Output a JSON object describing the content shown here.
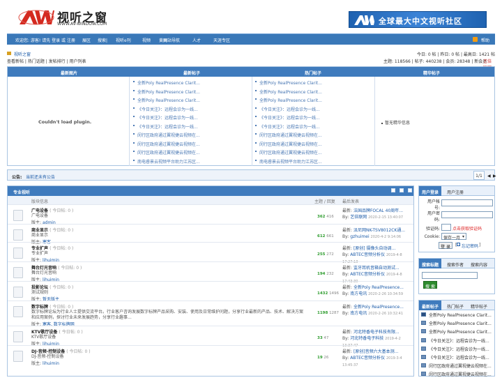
{
  "logo": {
    "cn": "视听之窗",
    "url": "WWW.AV-WINDOW.COM",
    "mark": "AW"
  },
  "banner": {
    "text": "全球最大中文视听社区",
    "mark": "AW"
  },
  "nav": {
    "items": [
      "欢迎您: 游客! 请先 登录 或 注册",
      "展区",
      "搜索|",
      "视听e刊",
      "视频",
      "黄页",
      "网站导航",
      "人才",
      "天涯专区",
      "",
      "",
      "帮助"
    ]
  },
  "info": {
    "breadcrumb": "视听之窗",
    "links": "查看新帖 | 热门话题 | 发帖排行 | 用户列表",
    "today": "今日: 0 帖 | 昨日: 0 帖 | 最高日: 1421 帖",
    "stats": "主题: 118566 | 帖子: 440238 | 会员: 28348 | 新会员",
    "newmember": "艺倍联网"
  },
  "top": {
    "headers": [
      "最新图片",
      "最新帖子",
      "热门帖子",
      "精华帖子"
    ],
    "noplugin": "Couldn't load plugin.",
    "newest": [
      "全新Poly RealPresence Clarit...",
      "全新Poly RealPresence Clarit...",
      "全新Poly RealPresence Clarit...",
      "《今日关注》：远程会诊为一线...",
      "《今日关注》：远程会诊为一线...",
      "《今日关注》：远程会诊为一线...",
      "闵行区政府通过翼视捷云视频在...",
      "闵行区政府通过翼视捷云视频在...",
      "闵行区政府通过翼视捷云视频在...",
      "南电睿景云视频平台助力江苏区..."
    ],
    "hot": [
      "全新Poly RealPresence Clarit...",
      "全新Poly RealPresence Clarit...",
      "全新Poly RealPresence Clarit...",
      "《今日关注》：远程会诊为一线...",
      "《今日关注》：远程会诊为一线...",
      "《今日关注》：远程会诊为一线...",
      "闵行区政府通过翼视捷云视频在...",
      "闵行区政府通过翼视捷云视频在...",
      "闵行区政府通过翼视捷云视频在...",
      "南电睿景云视频平台助力江苏区..."
    ],
    "elite": "暂无精华信息"
  },
  "notice": {
    "label": "公告:",
    "text": "当前还未有公告",
    "page": "1/1",
    "prev": "◀",
    "next": "▶"
  },
  "forum": {
    "title": "专业视听",
    "cols": [
      "版块信息",
      "主题 / 回复",
      "最后发表"
    ],
    "rows": [
      {
        "name": "广电设备",
        "today": "( 今日帖: 0 )",
        "desc": "广电设备",
        "modlabel": "版主:",
        "mod": "admin",
        "topics": "362",
        "posts": "416",
        "last_label": "最新:",
        "last": "法国品牌FOCAL 40周年...",
        "by": "By:",
        "user": "艺倍联网",
        "time": "2020-2-15 13:40:07"
      },
      {
        "name": "商业显示",
        "today": "( 今日帖: 0 )",
        "desc": "商业显示",
        "modlabel": "版主:",
        "mod": "寒客",
        "topics": "612",
        "posts": "661",
        "last_label": "最新:",
        "last": "派尼网NK-TSV8012CK通...",
        "by": "By:",
        "user": "gzhuimei",
        "time": "2020-4-2 9:14:06"
      },
      {
        "name": "专业扩声",
        "today": "( 今日帖: 0 )",
        "desc": "专业扩声",
        "modlabel": "版主:",
        "mod": "lihuimin",
        "topics": "255",
        "posts": "272",
        "last_label": "最新:",
        "last": "[原创] 摄像头自动调...",
        "by": "By:",
        "user": "ABTEC音频分析仪",
        "time": "2019-4-8 17:27:13"
      },
      {
        "name": "舞台灯光音响",
        "today": "( 今日帖: 0 )",
        "desc": "舞台灯光音响",
        "modlabel": "版主:",
        "mod": "lihuimin",
        "topics": "194",
        "posts": "232",
        "last_label": "最新:",
        "last": "监牙耳机音箱自动测试...",
        "by": "By:",
        "user": "ABTEC音频分析仪",
        "time": "2019-4-8 17:43:30"
      },
      {
        "name": "投影论坛",
        "today": "( 今日帖: 0 )",
        "desc": "测试规则",
        "modlabel": "版主:",
        "mod": "暂无版主",
        "topics": "1432",
        "posts": "1496",
        "last_label": "最新:",
        "last": "全新Poly RealPresence...",
        "by": "By:",
        "user": "南方电讯",
        "time": "2020-2-26 10:34:59"
      },
      {
        "name": "数字标牌",
        "today": "( 今日帖: 0 )",
        "desc": "数字标牌论坛为行业人士提供交流平台。行业客户咨询发展数字标牌产品采购、安装、使用及日常维护问题，分享行业最新的产品、技术、解决方案和应用案例，探讨行业未来发展趋势，分享行业趣事...",
        "modlabel": "版主:",
        "mod": "寒客, 数字标牌网",
        "topics": "1198",
        "posts": "1287",
        "last_label": "最新:",
        "last": "全新Poly RealPresence...",
        "by": "By:",
        "user": "南方电讯",
        "time": "2020-2-26 10:32:41"
      },
      {
        "name": "KTV歌厅设备",
        "today": "( 今日帖: 0 )",
        "desc": "KTV歌厅设备",
        "modlabel": "版主:",
        "mod": "lihuimin",
        "topics": "33",
        "posts": "47",
        "last_label": "最新:",
        "last": "河北特香电子科技有限...",
        "by": "By:",
        "user": "河北特香电子科技",
        "time": "2019-4-2 13:37:47"
      },
      {
        "name": "DJ-音频-控制设备",
        "today": "( 今日帖: 0 )",
        "desc": "DJ-音频-控制设备",
        "modlabel": "版主:",
        "mod": "lihuimin",
        "topics": "19",
        "posts": "26",
        "last_label": "最新:",
        "last": "[原创]音频六大基本测...",
        "by": "By:",
        "user": "ABTEC音频分析仪",
        "time": "2019-3-4 13:45:37"
      }
    ]
  },
  "login": {
    "tabs": [
      "用户登录",
      "用户注册"
    ],
    "user_label": "用户帐号:",
    "pass_label": "用户密码:",
    "code_label": "验证码:",
    "code_hint": "点击获取验证码",
    "cookie_label": "Cookie:",
    "cookie_value": "保存一月",
    "submit": "登 录",
    "forgot": "忘记密码"
  },
  "search": {
    "tabs": [
      "搜索标题",
      "搜索作者",
      "搜索内容"
    ],
    "button": "搜 索"
  },
  "newtopics": {
    "tabs": [
      "最新帖子",
      "热门帖子",
      "精华帖子"
    ],
    "items": [
      "全新Poly RealPresence Clarit...",
      "全新Poly RealPresence Clarit...",
      "全新Poly RealPresence Clarit...",
      "《今日关注》：远程会诊为一线...",
      "《今日关注》：远程会诊为一线...",
      "《今日关注》：远程会诊为一线...",
      "闵行区政府通过翼视捷云视频在...",
      "闵行区政府通过翼视捷云视频在..."
    ]
  },
  "colors": {
    "brand": "#3f7bbd",
    "link": "#1a5aa8",
    "green": "#2d9c2d"
  }
}
